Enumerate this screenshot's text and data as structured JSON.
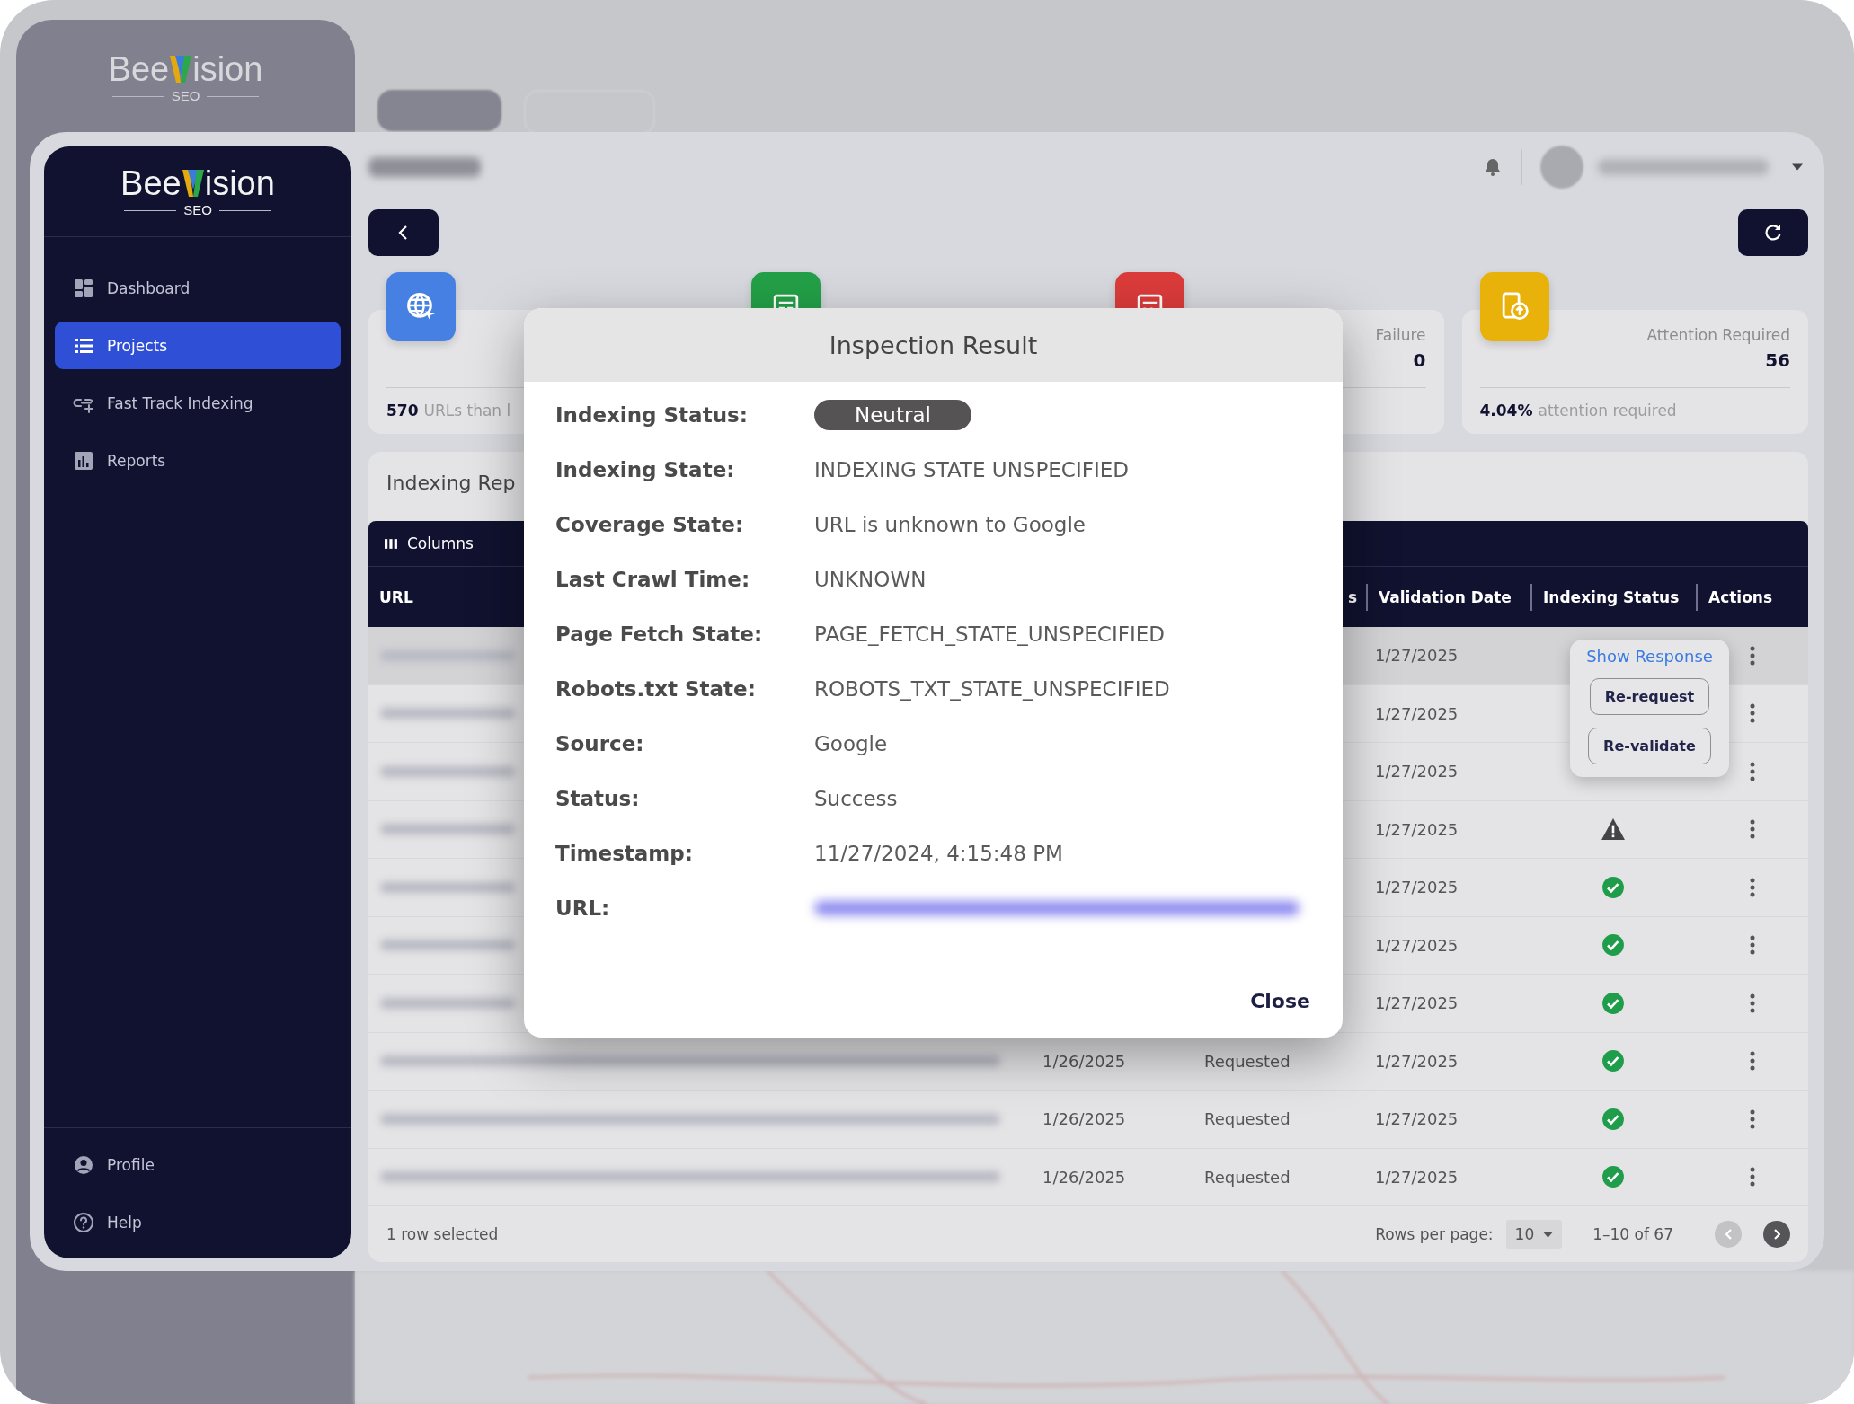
{
  "background_app": {
    "logo": {
      "left": "Bee",
      "right": "ision",
      "tagline": "SEO"
    }
  },
  "sidebar": {
    "logo": {
      "left": "Bee",
      "right": "ision",
      "tagline": "SEO"
    },
    "items": [
      {
        "label": "Dashboard",
        "selected": false
      },
      {
        "label": "Projects",
        "selected": true
      },
      {
        "label": "Fast Track Indexing",
        "selected": false
      },
      {
        "label": "Reports",
        "selected": false
      }
    ],
    "bottom_items": [
      {
        "label": "Profile"
      },
      {
        "label": "Help"
      }
    ]
  },
  "stat_cards": [
    {
      "color": "#4580e2",
      "footer_value": "570",
      "footer_text": "URLs than l"
    },
    {
      "color": "#23a047"
    },
    {
      "color": "#dc3b3b",
      "title": "Failure",
      "value": "0"
    },
    {
      "color": "#e8b20b",
      "title": "Attention Required",
      "value": "56",
      "footer_value": "4.04%",
      "footer_text": "attention required"
    }
  ],
  "report": {
    "title": "Indexing Rep",
    "toolbar": [
      "Columns"
    ],
    "columns": [
      "URL",
      "",
      "s",
      "Validation Date",
      "Indexing Status",
      "Actions"
    ],
    "rows": [
      {
        "selected": true,
        "validation_date": "1/27/2025"
      },
      {
        "selected": false,
        "validation_date": "1/27/2025"
      },
      {
        "selected": false,
        "validation_date": "1/27/2025"
      },
      {
        "selected": false,
        "validation_date": "1/27/2025",
        "kind": "warning"
      },
      {
        "selected": false,
        "validation_date": "1/27/2025",
        "kind": "success"
      },
      {
        "selected": false,
        "validation_date": "1/27/2025",
        "kind": "success"
      },
      {
        "selected": false,
        "validation_date": "1/27/2025",
        "kind": "success"
      },
      {
        "selected": false,
        "column_2": "1/26/2025",
        "column_3": "Requested",
        "validation_date": "1/27/2025",
        "kind": "success"
      },
      {
        "selected": false,
        "column_2": "1/26/2025",
        "column_3": "Requested",
        "validation_date": "1/27/2025",
        "kind": "success"
      },
      {
        "selected": false,
        "column_2": "1/26/2025",
        "column_3": "Requested",
        "validation_date": "1/27/2025",
        "kind": "success"
      }
    ],
    "row_menu": {
      "link": "Show Response",
      "buttons": [
        "Re-request",
        "Re-validate"
      ]
    },
    "footer": {
      "selection": "1 row selected",
      "rows_per_page_label": "Rows per page:",
      "rows_per_page": "10",
      "range": "1–10 of 67",
      "prev_disabled": true,
      "next_disabled": false
    }
  },
  "dialog": {
    "title": "Inspection Result",
    "fields": [
      {
        "label": "Indexing Status:",
        "kind": "badge",
        "value": "Neutral"
      },
      {
        "label": "Indexing State:",
        "kind": "text",
        "value": "INDEXING STATE UNSPECIFIED"
      },
      {
        "label": "Coverage State:",
        "kind": "text",
        "value": "URL is unknown to Google"
      },
      {
        "label": "Last Crawl Time:",
        "kind": "text",
        "value": "UNKNOWN"
      },
      {
        "label": "Page Fetch State:",
        "kind": "text",
        "value": "PAGE_FETCH_STATE_UNSPECIFIED"
      },
      {
        "label": "Robots.txt State:",
        "kind": "text",
        "value": "ROBOTS_TXT_STATE_UNSPECIFIED"
      },
      {
        "label": "Source:",
        "kind": "text",
        "value": "Google"
      },
      {
        "label": "Status:",
        "kind": "text",
        "value": "Success"
      },
      {
        "label": "Timestamp:",
        "kind": "text",
        "value": "11/27/2024, 4:15:48 PM"
      },
      {
        "label": "URL:",
        "kind": "blurred"
      }
    ],
    "close": "Close"
  }
}
